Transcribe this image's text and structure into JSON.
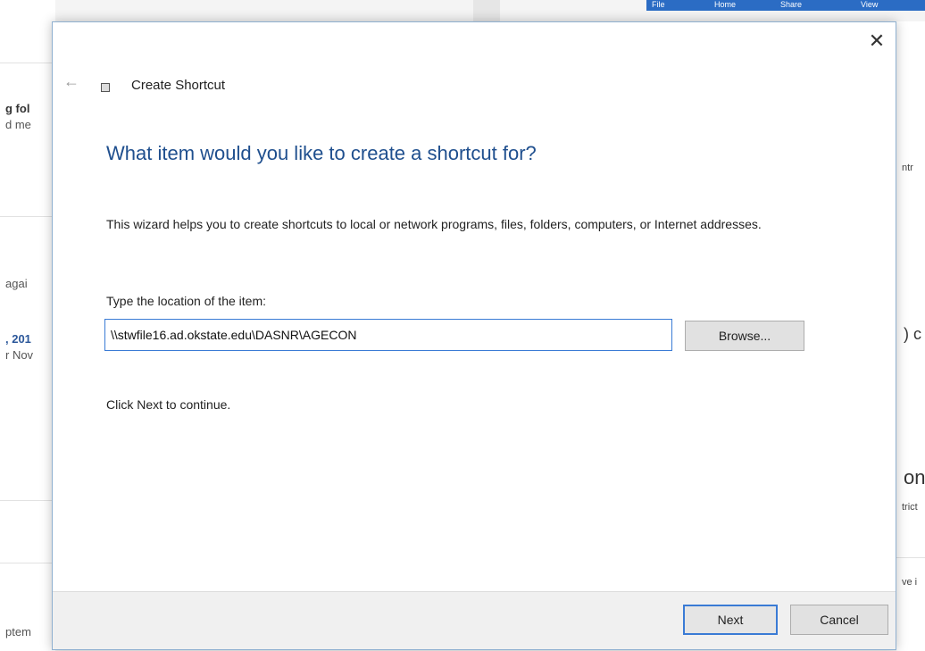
{
  "background": {
    "left_snippets": [
      "g fol",
      "d me",
      "agai",
      ", 201",
      "r Nov",
      "ptem"
    ],
    "ribbon_tabs": [
      "File",
      "Home",
      "Share",
      "View"
    ],
    "right_snippets": [
      "ntr",
      ") c",
      "on",
      "trict",
      "ve i"
    ]
  },
  "dialog": {
    "close_symbol": "✕",
    "back_symbol": "←",
    "title": "Create Shortcut",
    "heading": "What item would you like to create a shortcut for?",
    "description": "This wizard helps you to create shortcuts to local or network programs, files, folders, computers, or Internet addresses.",
    "location_label": "Type the location of the item:",
    "location_value": "\\\\stwfile16.ad.okstate.edu\\DASNR\\AGECON",
    "browse_label": "Browse...",
    "hint": "Click Next to continue.",
    "next_label": "Next",
    "cancel_label": "Cancel"
  },
  "colors": {
    "heading": "#1f4f8e",
    "accent": "#3a7bd5"
  }
}
